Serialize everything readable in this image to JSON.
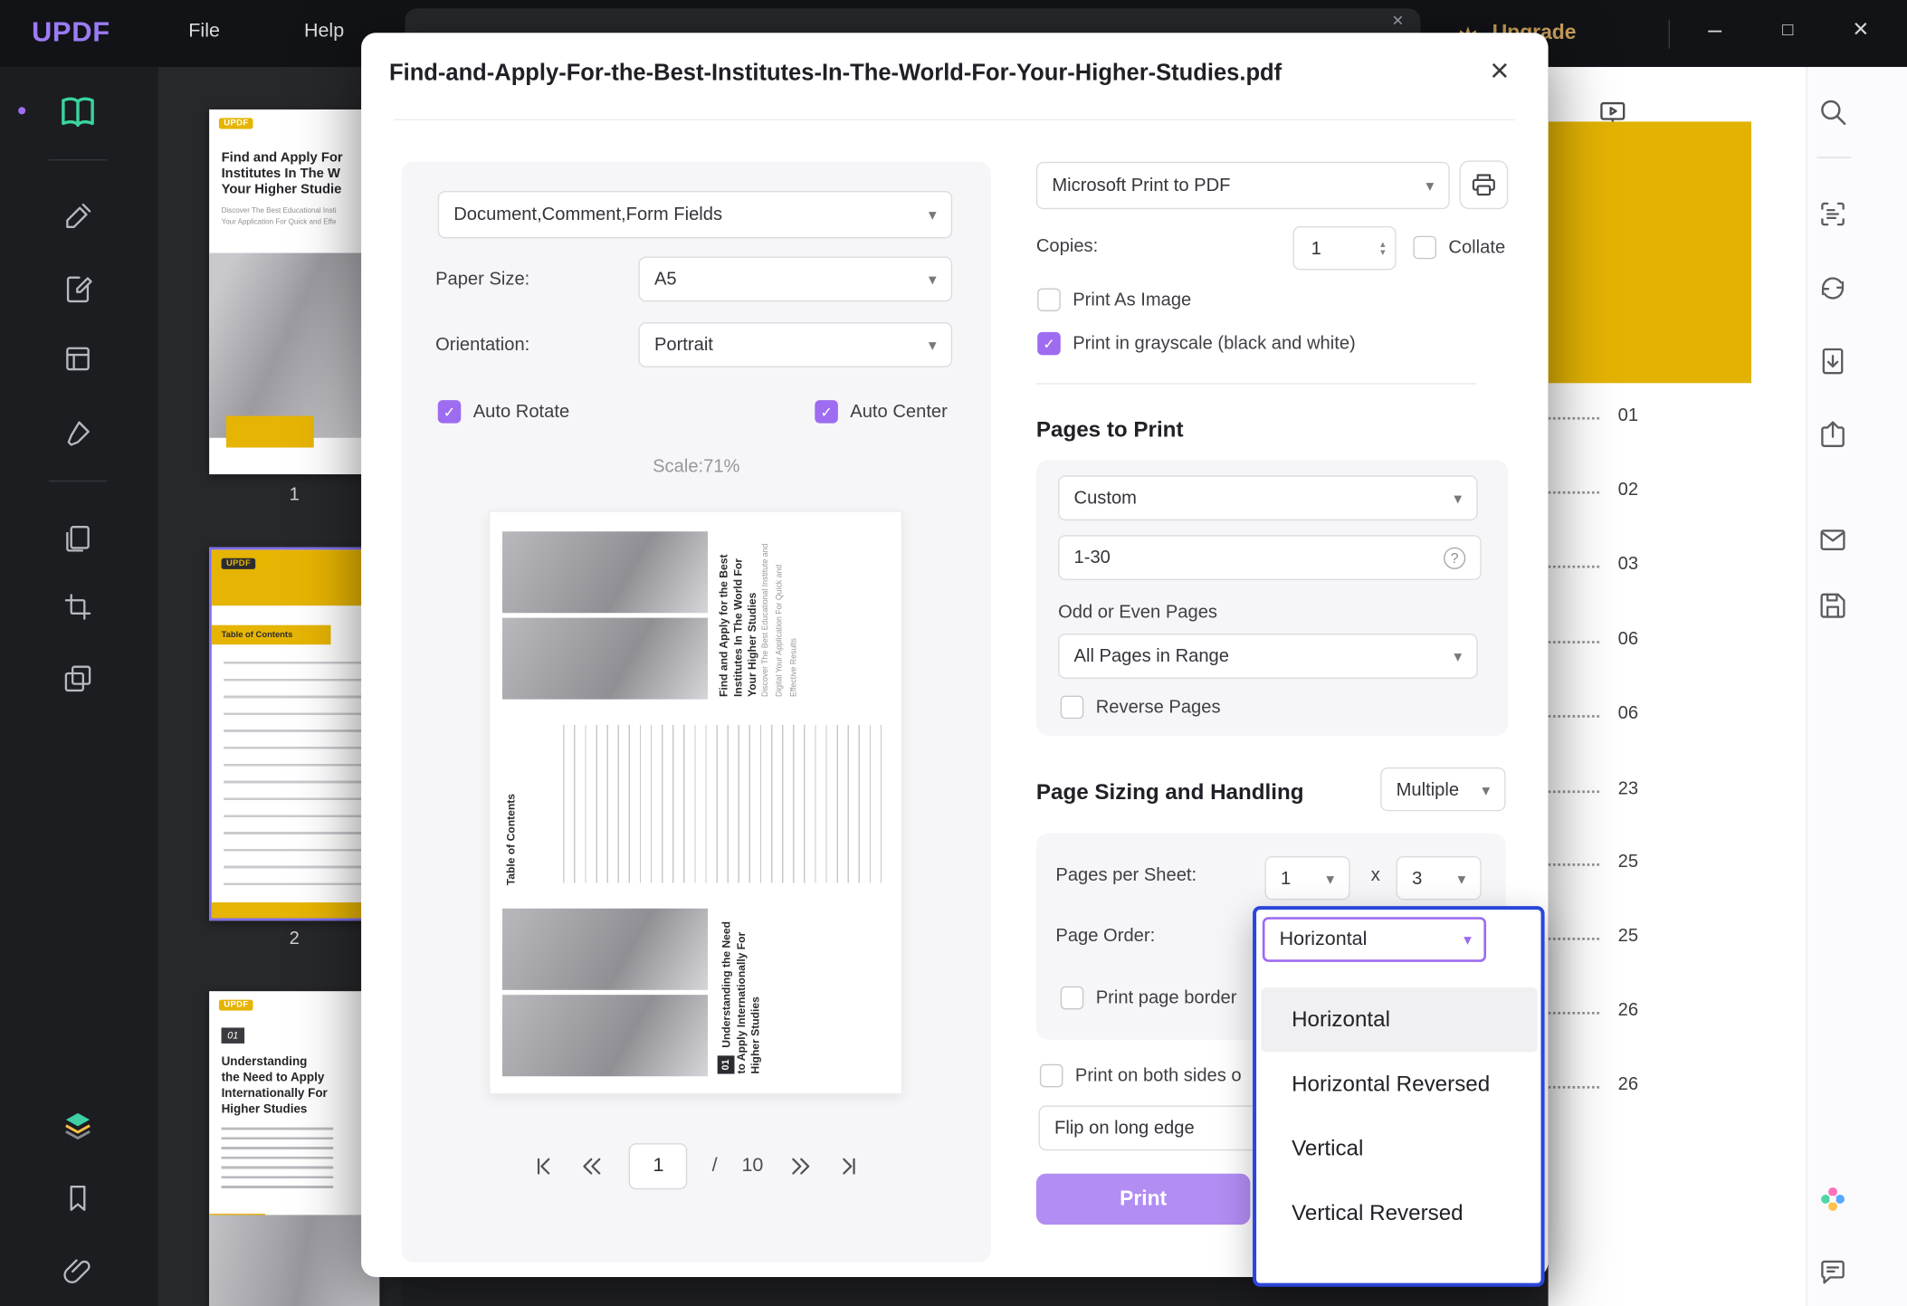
{
  "icons": {
    "chevron_down": "▾",
    "spinner_up": "▴",
    "spinner_down": "▾",
    "close": "×",
    "minimize": "–",
    "maximize": "□",
    "check": "✓",
    "question": "?"
  },
  "colors": {
    "accent_purple": "#9d6cf0",
    "print_button_purple": "#b28df3",
    "dropdown_border_blue": "#2b46d9",
    "brand_yellow": "#e3b303",
    "upgrade_gold": "#c9a05a"
  },
  "titlebar": {
    "logo": "UPDF",
    "file": "File",
    "help": "Help",
    "upgrade": "Upgrade"
  },
  "thumbnails": {
    "page1": {
      "brand": "UPDF",
      "titles": [
        "Find and Apply For",
        "Institutes In The W",
        "Your Higher Studie"
      ],
      "subtitles": [
        "Discover The Best Educational Insti",
        "Your Application For Quick and Effe"
      ],
      "label": "1"
    },
    "page2": {
      "brand": "UPDF",
      "ribbon": "Table of Contents",
      "label": "2"
    },
    "page3": {
      "brand": "UPDF",
      "badge": "01",
      "titles": [
        "Understanding",
        "the Need to Apply",
        "Internationally For",
        "Higher Studies"
      ]
    }
  },
  "dialog": {
    "title": "Find-and-Apply-For-the-Best-Institutes-In-The-World-For-Your-Higher-Studies.pdf",
    "content_select": "Document,Comment,Form Fields",
    "paper_size_label": "Paper Size:",
    "paper_size_value": "A5",
    "orientation_label": "Orientation:",
    "orientation_value": "Portrait",
    "auto_rotate": "Auto Rotate",
    "auto_center": "Auto Center",
    "scale_text": "Scale:71%",
    "preview": {
      "cover_title": "Find and Apply for the Best Institutes In The World For Your Higher Studies",
      "cover_subtitle": "Discover The Best Educational Institute and Digital Your Application For Quick and Effective Results",
      "toc_title": "Table of Contents",
      "section_badge": "01",
      "section_title": "Understanding the Need to Apply Internationally For Higher Studies"
    },
    "pager": {
      "current": "1",
      "sep": "/",
      "total": "10"
    },
    "printer_value": "Microsoft Print to PDF",
    "copies_label": "Copies:",
    "copies_value": "1",
    "collate": "Collate",
    "print_as_image": "Print As Image",
    "grayscale": "Print in grayscale (black and white)",
    "pages_to_print": {
      "heading": "Pages to Print",
      "mode": "Custom",
      "range": "1-30",
      "odd_even_label": "Odd or Even Pages",
      "odd_even_value": "All Pages in Range",
      "reverse": "Reverse Pages"
    },
    "sizing": {
      "heading": "Page Sizing and Handling",
      "mode": "Multiple",
      "pages_per_sheet_label": "Pages per Sheet:",
      "sheet_cols": "1",
      "sheet_times": "x",
      "sheet_rows": "3",
      "page_order_label": "Page Order:",
      "page_order_value": "Horizontal",
      "print_page_border": "Print page border",
      "both_sides": "Print on both sides o",
      "flip_long_edge": "Flip on long edge"
    },
    "print_button": "Print"
  },
  "page_order_dropdown": {
    "value": "Horizontal",
    "options": [
      "Horizontal",
      "Horizontal Reversed",
      "Vertical",
      "Vertical Reversed"
    ]
  },
  "document_view": {
    "toc_page_numbers": [
      "01",
      "02",
      "03",
      "06",
      "06",
      "23",
      "25",
      "25",
      "26",
      "26"
    ]
  }
}
